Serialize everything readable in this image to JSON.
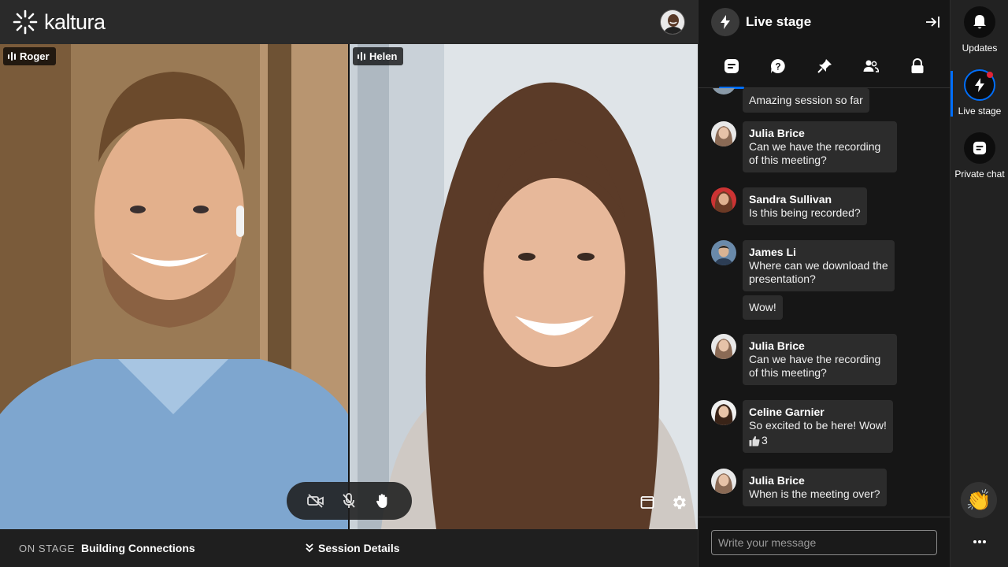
{
  "brand": {
    "name": "kaltura"
  },
  "stage": {
    "participants": [
      {
        "name": "Roger"
      },
      {
        "name": "Helen"
      }
    ],
    "controls": [
      "camera-off-icon",
      "mic-off-icon",
      "raise-hand-icon"
    ]
  },
  "bottom_bar": {
    "on_stage_label": "ON STAGE",
    "session_title": "Building Connections",
    "session_details_label": "Session Details"
  },
  "panel": {
    "title": "Live stage",
    "tabs": [
      "chat-icon",
      "question-icon",
      "pin-icon",
      "people-icon",
      "lock-icon"
    ],
    "messages": [
      {
        "text": "Amazing session so far"
      },
      {
        "author": "Julia Brice",
        "text": "Can we have the recording of this meeting?"
      },
      {
        "author": "Sandra Sullivan",
        "text": "Is this being recorded?"
      },
      {
        "author": "James Li",
        "text": "Where can we download the presentation?"
      },
      {
        "text": "Wow!"
      },
      {
        "author": "Julia Brice",
        "text": "Can we have the recording of this meeting?"
      },
      {
        "author": "Celine Garnier",
        "text": "So excited to be here! Wow!",
        "reaction_count": "3"
      },
      {
        "author": "Julia Brice",
        "text": "When is the meeting over?"
      }
    ],
    "composer_placeholder": "Write your message"
  },
  "rail": {
    "items": [
      {
        "label": "Updates"
      },
      {
        "label": "Live stage"
      },
      {
        "label": "Private chat"
      }
    ]
  },
  "colors": {
    "accent": "#006efa",
    "notification": "#e12437"
  }
}
